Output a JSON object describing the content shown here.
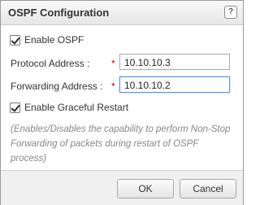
{
  "dialog": {
    "title": "OSPF Configuration",
    "help_icon": "question-mark-icon",
    "help_glyph": "?"
  },
  "form": {
    "enable_ospf": {
      "label": "Enable OSPF",
      "checked": true
    },
    "protocol_address": {
      "label": "Protocol Address :",
      "required_marker": "*",
      "value": "10.10.10.3"
    },
    "forwarding_address": {
      "label": "Forwarding Address :",
      "required_marker": "*",
      "value": "10.10.10.2"
    },
    "graceful_restart": {
      "label": "Enable Graceful Restart",
      "checked": true
    },
    "graceful_restart_description": "(Enables/Disables the capability to perform Non-Stop Forwarding of packets during restart of OSPF process)"
  },
  "footer": {
    "ok_label": "OK",
    "cancel_label": "Cancel"
  },
  "colors": {
    "required": "#d40000",
    "focus_border": "#5b95d6"
  }
}
